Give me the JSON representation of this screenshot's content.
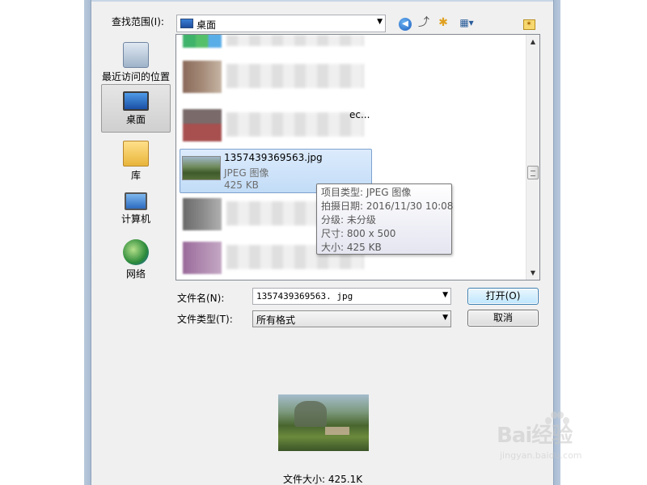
{
  "lookin": {
    "label": "查找范围(I):",
    "value": "桌面"
  },
  "places": [
    {
      "label": "最近访问的位置",
      "icon": "recent-places-icon"
    },
    {
      "label": "桌面",
      "icon": "desktop-icon"
    },
    {
      "label": "库",
      "icon": "library-icon"
    },
    {
      "label": "计算机",
      "icon": "computer-icon"
    },
    {
      "label": "网络",
      "icon": "network-icon"
    }
  ],
  "selected_file": {
    "name": "1357439369563.jpg",
    "type": "JPEG 图像",
    "size": "425 KB"
  },
  "tooltip": {
    "type": "项目类型: JPEG 图像",
    "date": "拍摄日期: 2016/11/30 10:08",
    "rating": "分级: 未分级",
    "dims": "尺寸: 800 x 500",
    "size": "大小: 425 KB"
  },
  "filename": {
    "label": "文件名(N):",
    "value": "1357439369563. jpg"
  },
  "filetype": {
    "label": "文件类型(T):",
    "value": "所有格式"
  },
  "buttons": {
    "open": "打开(O)",
    "cancel": "取消"
  },
  "preview": {
    "size_text": "文件大小: 425.1K"
  },
  "blurred_fragment": "ec...",
  "watermark": {
    "logo": "Bai经验",
    "url": "jingyan.baidu.com"
  }
}
